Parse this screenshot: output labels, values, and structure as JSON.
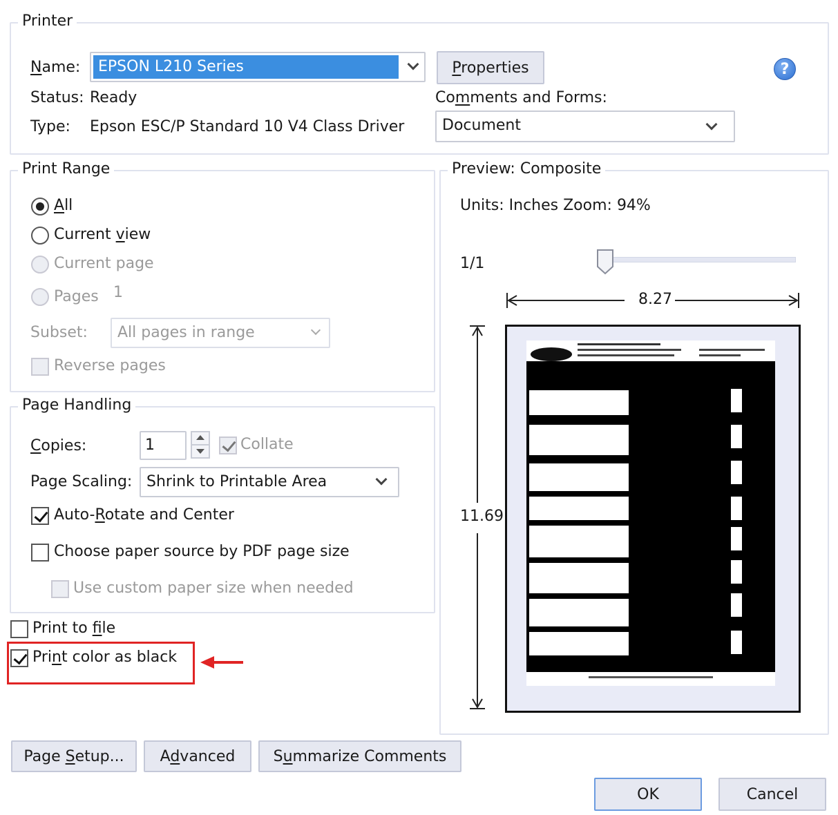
{
  "printer": {
    "group_label": "Printer",
    "name_label": "Name:",
    "name_value": "EPSON L210 Series",
    "properties_label": "Properties",
    "status_label": "Status:",
    "status_value": "Ready",
    "type_label": "Type:",
    "type_value": "Epson ESC/P Standard 10 V4 Class Driver",
    "comments_label": "Comments and Forms:",
    "comments_value": "Document",
    "help_icon": "help-icon"
  },
  "print_range": {
    "group_label": "Print Range",
    "all_label": "All",
    "all_selected": true,
    "current_view_label": "Current view",
    "current_page_label": "Current page",
    "pages_label": "Pages",
    "pages_value": "1",
    "subset_label": "Subset:",
    "subset_value": "All pages in range",
    "reverse_label": "Reverse pages"
  },
  "page_handling": {
    "group_label": "Page Handling",
    "copies_label": "Copies:",
    "copies_value": "1",
    "collate_label": "Collate",
    "collate_checked": true,
    "scaling_label": "Page Scaling:",
    "scaling_value": "Shrink to Printable Area",
    "auto_rotate_label": "Auto-Rotate and Center",
    "auto_rotate_checked": true,
    "paper_source_label": "Choose paper source by PDF page size",
    "paper_source_checked": false,
    "custom_paper_label": "Use custom paper size when needed"
  },
  "options": {
    "print_to_file_label": "Print to file",
    "print_to_file_checked": false,
    "print_color_black_label": "Print color as black",
    "print_color_black_checked": true,
    "annotation_color": "#e02424"
  },
  "preview": {
    "group_label": "Preview: Composite",
    "units_zoom": "Units: Inches Zoom:  94%",
    "page_counter": "1/1",
    "width_label": "8.27",
    "height_label": "11.69"
  },
  "buttons": {
    "page_setup": "Page Setup...",
    "advanced": "Advanced",
    "summarize": "Summarize Comments",
    "ok": "OK",
    "cancel": "Cancel"
  },
  "colors": {
    "selection": "#3b8ee0",
    "button_bg": "#e6e8f1",
    "group_border": "#dfe2ee"
  }
}
